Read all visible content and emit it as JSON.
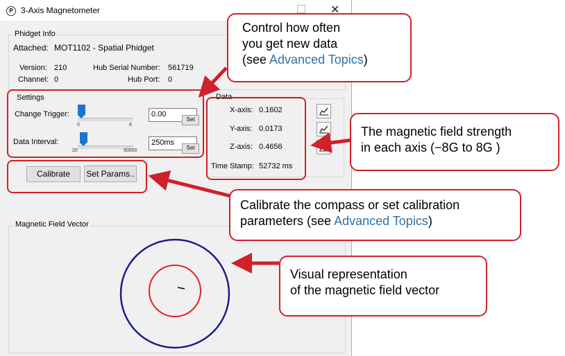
{
  "window": {
    "title": "3-Axis Magnetometer",
    "close_glyph": "✕"
  },
  "phidget_info": {
    "group_label": "Phidget Info",
    "attached_label": "Attached:",
    "attached_value": "MOT1102 - Spatial Phidget",
    "version_label": "Version:",
    "version_value": "210",
    "hub_serial_label": "Hub Serial Number:",
    "hub_serial_value": "561719",
    "channel_label": "Channel:",
    "channel_value": "0",
    "hub_port_label": "Hub Port:",
    "hub_port_value": "0"
  },
  "settings": {
    "group_label": "Settings",
    "change_trigger_label": "Change Trigger:",
    "change_trigger_value": "0.00",
    "change_trigger_min": "0",
    "change_trigger_max": "8",
    "change_trigger_position": 0.0,
    "data_interval_label": "Data Interval:",
    "data_interval_value": "250ms",
    "data_interval_min": "20",
    "data_interval_max": "60000",
    "data_interval_position": 0.04,
    "set_label": "Set"
  },
  "buttons": {
    "calibrate": "Calibrate",
    "set_params": "Set Params.."
  },
  "data": {
    "group_label": "Data",
    "x_label": "X-axis:",
    "x_value": "0.1602",
    "y_label": "Y-axis:",
    "y_value": "0.0173",
    "z_label": "Z-axis:",
    "z_value": "0.4656",
    "timestamp_label": "Time Stamp:",
    "timestamp_value": "52732 ms"
  },
  "vector": {
    "group_label": "Magnetic Field Vector"
  },
  "callouts": {
    "data_rate": {
      "line1": "Control how often",
      "line2": "you get new data",
      "line3_pre": "(see ",
      "link": "Advanced Topics",
      "line3_post": ")"
    },
    "field_strength": {
      "line1": "The magnetic field strength",
      "line2": "in each axis (−8G to 8G )"
    },
    "calibrate": {
      "line1": "Calibrate the compass or set calibration",
      "line2_pre": "parameters (see ",
      "link": "Advanced Topics",
      "line2_post": ")"
    },
    "visual": {
      "line1": "Visual representation",
      "line2": "of the magnetic field vector"
    }
  },
  "colors": {
    "callout_border": "#d0202a",
    "link": "#2e72a8",
    "outer_circle": "#1a1a8c",
    "inner_circle": "#e02020",
    "slider_thumb": "#1e73d2"
  }
}
